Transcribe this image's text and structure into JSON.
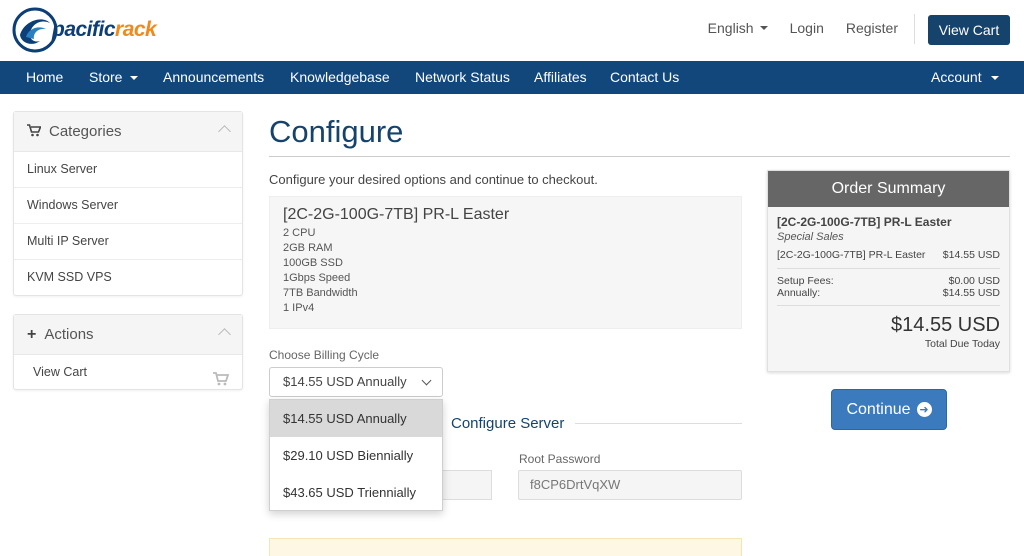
{
  "brand": {
    "part1": "pacific",
    "part2": "rack"
  },
  "header": {
    "language": "English",
    "login": "Login",
    "register": "Register",
    "view_cart": "View Cart"
  },
  "nav": {
    "home": "Home",
    "store": "Store",
    "announcements": "Announcements",
    "knowledgebase": "Knowledgebase",
    "network_status": "Network Status",
    "affiliates": "Affiliates",
    "contact": "Contact Us",
    "account": "Account"
  },
  "sidebar": {
    "categories_title": "Categories",
    "categories": [
      "Linux Server",
      "Windows Server",
      "Multi IP Server",
      "KVM SSD VPS"
    ],
    "actions_title": "Actions",
    "actions_view_cart": "View Cart"
  },
  "main": {
    "title": "Configure",
    "intro": "Configure your desired options and continue to checkout.",
    "product": {
      "name": "[2C-2G-100G-7TB] PR-L Easter",
      "specs": [
        "2 CPU",
        "2GB RAM",
        "100GB SSD",
        "1Gbps Speed",
        "7TB Bandwidth",
        "1 IPv4"
      ]
    },
    "billing_label": "Choose Billing Cycle",
    "billing_selected": "$14.55 USD Annually",
    "billing_options": [
      "$14.55 USD Annually",
      "$29.10 USD Biennially",
      "$43.65 USD Triennially"
    ],
    "configure_server": "Configure Server",
    "root_password_label": "Root Password",
    "root_password_value": "f8CP6DrtVqXW"
  },
  "summary": {
    "title": "Order Summary",
    "product": "[2C-2G-100G-7TB] PR-L Easter",
    "group": "Special Sales",
    "line_name": "[2C-2G-100G-7TB] PR-L Easter",
    "line_price": "$14.55 USD",
    "setup_label": "Setup Fees:",
    "setup_value": "$0.00 USD",
    "annually_label": "Annually:",
    "annually_value": "$14.55 USD",
    "total": "$14.55 USD",
    "total_label": "Total Due Today",
    "continue": "Continue"
  },
  "colors": {
    "navbar": "#11477b",
    "primary": "#15436b",
    "continue": "#3a7abd",
    "accent": "#f08a1c"
  },
  "icons": [
    "cart-icon",
    "plus-icon",
    "chevron-up-icon",
    "chevron-down-icon",
    "arrow-right-circle-icon"
  ]
}
